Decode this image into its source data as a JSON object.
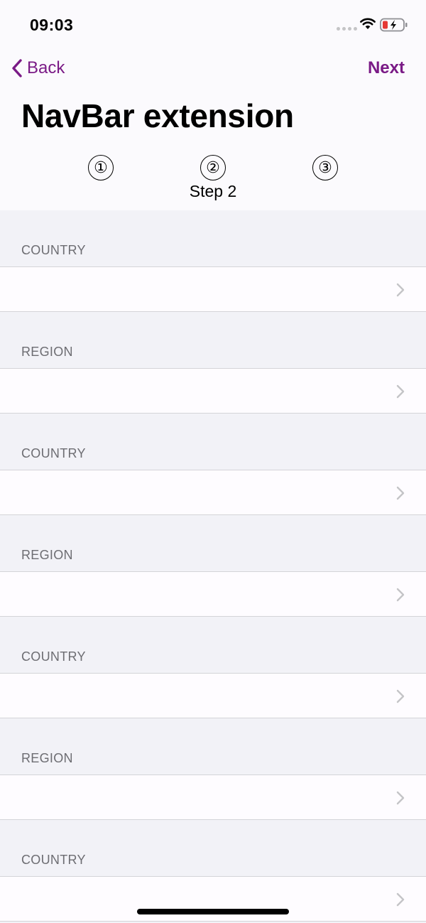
{
  "status_bar": {
    "time": "09:03",
    "icons": [
      "signal-dots-icon",
      "wifi-icon",
      "battery-charging-icon"
    ],
    "battery_color": "#e53935"
  },
  "nav": {
    "back_label": "Back",
    "next_label": "Next",
    "title": "NavBar extension",
    "accent_color": "#7a1a86"
  },
  "steps": {
    "items": [
      "①",
      "②",
      "③"
    ],
    "current_caption": "Step 2"
  },
  "sections": [
    {
      "header": "COUNTRY"
    },
    {
      "header": "REGION"
    },
    {
      "header": "COUNTRY"
    },
    {
      "header": "REGION"
    },
    {
      "header": "COUNTRY"
    },
    {
      "header": "REGION"
    },
    {
      "header": "COUNTRY"
    }
  ]
}
